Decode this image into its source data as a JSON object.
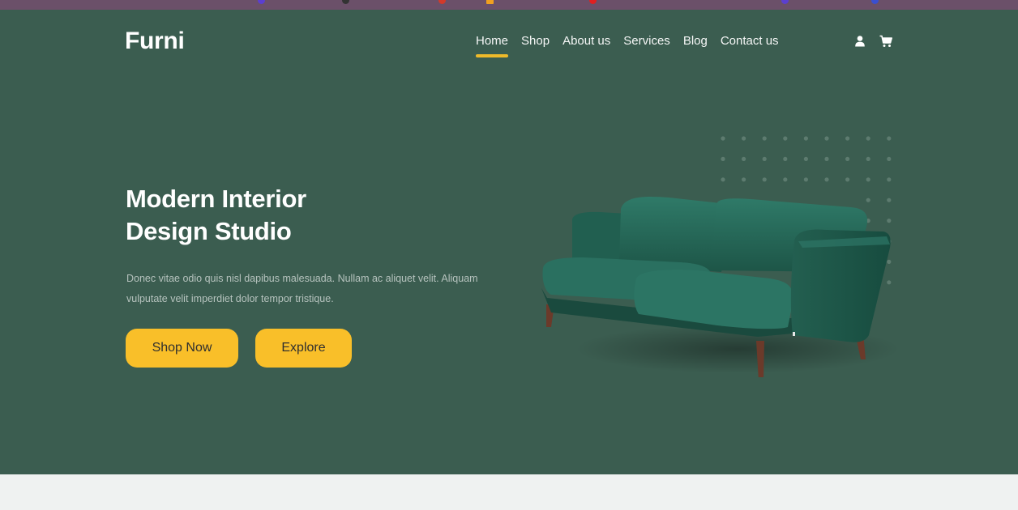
{
  "site": {
    "logo": "Furni"
  },
  "nav": {
    "items": [
      {
        "label": "Home",
        "active": true
      },
      {
        "label": "Shop",
        "active": false
      },
      {
        "label": "About us",
        "active": false
      },
      {
        "label": "Services",
        "active": false
      },
      {
        "label": "Blog",
        "active": false
      },
      {
        "label": "Contact us",
        "active": false
      }
    ],
    "icons": [
      "user-icon",
      "cart-icon"
    ]
  },
  "hero": {
    "title_line1": "Modern Interior",
    "title_line2": "Design Studio",
    "description": "Donec vitae odio quis nisl dapibus malesuada. Nullam ac aliquet velit. Aliquam vulputate velit imperdiet dolor tempor tristique.",
    "primary_button": "Shop Now",
    "secondary_button": "Explore"
  },
  "colors": {
    "hero_bg": "#3b5d50",
    "accent": "#f9bf29",
    "page_bg": "#eff2f1",
    "browser_strip": "#6b5069"
  }
}
